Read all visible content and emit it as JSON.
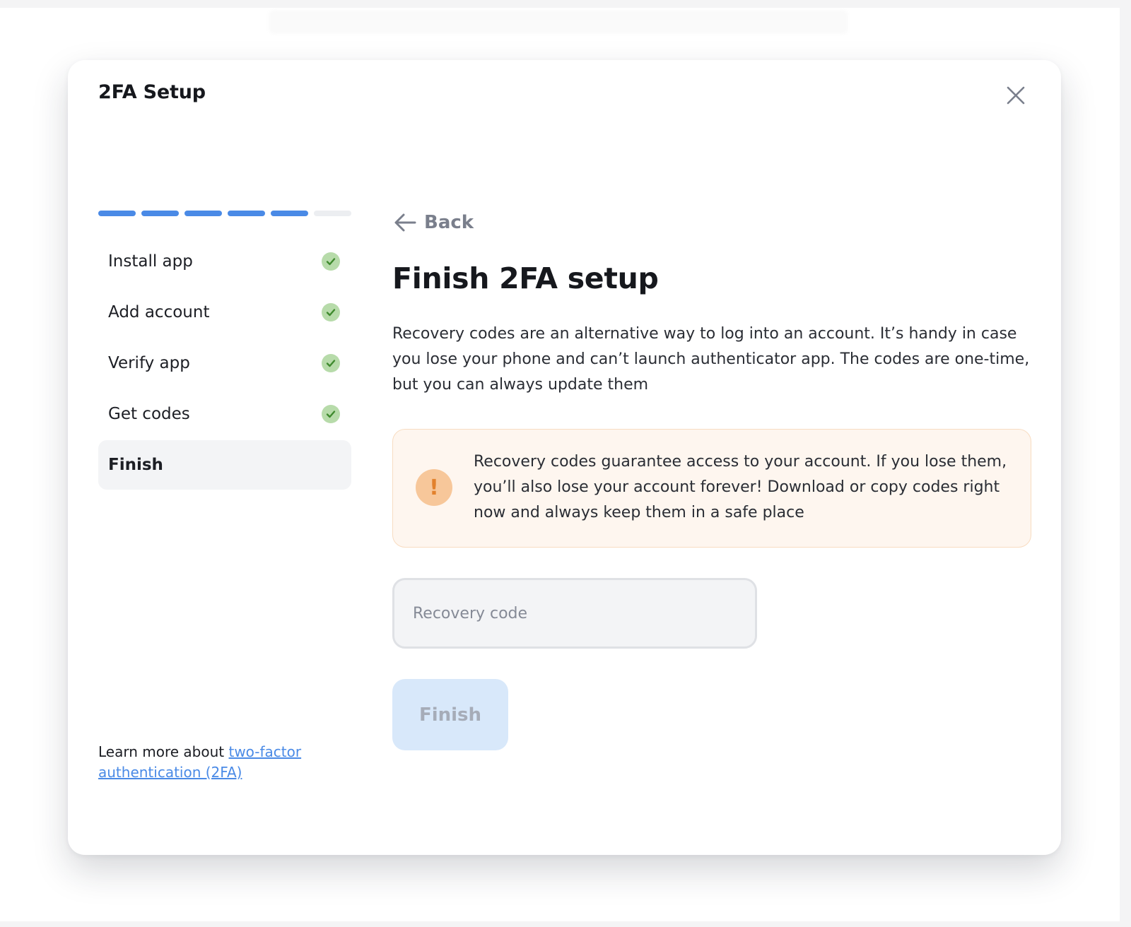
{
  "modal": {
    "title": "2FA Setup",
    "close_icon": "close-icon"
  },
  "progress": {
    "completed_steps": 5,
    "total_steps": 6,
    "color": "#4a8ae6"
  },
  "steps": [
    {
      "label": "Install app",
      "status": "done"
    },
    {
      "label": "Add account",
      "status": "done"
    },
    {
      "label": "Verify app",
      "status": "done"
    },
    {
      "label": "Get codes",
      "status": "done"
    },
    {
      "label": "Finish",
      "status": "active"
    }
  ],
  "learn_more": {
    "prefix": "Learn more about ",
    "link_text": "two-factor authentication (2FA)"
  },
  "main": {
    "back_label": "Back",
    "heading": "Finish 2FA setup",
    "description": "Recovery codes are an alternative way to log into an account. It’s handy in case you lose your phone and can’t launch authenticator app. The codes are one-time, but you can always update them",
    "warning": {
      "icon": "!",
      "text": "Recovery codes guarantee access to your account. If you lose them, you’ll also lose your account forever! Download or copy codes right now and always keep them in a safe place"
    },
    "recovery_input": {
      "value": "",
      "placeholder": "Recovery code"
    },
    "finish_button": "Finish"
  },
  "colors": {
    "accent": "#4a8ae6",
    "success": "#b7dbaa",
    "warning_bg": "#fef6ef",
    "warning_icon": "#f7c79a"
  }
}
